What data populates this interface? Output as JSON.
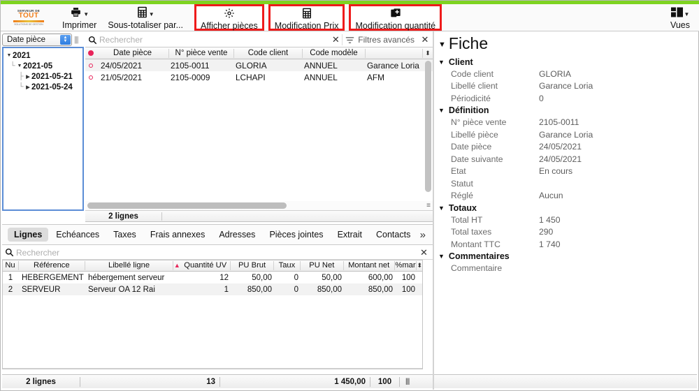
{
  "toolbar": {
    "logo": {
      "line1": "SERVEUR DE",
      "line2": "TOUT",
      "line4": "SOLUTIONS DE GESTION"
    },
    "items": [
      {
        "label": "Imprimer",
        "icon": "printer-icon",
        "caret": true,
        "highlight": false
      },
      {
        "label": "Sous-totaliser par...",
        "icon": "calculator-icon",
        "caret": true,
        "highlight": false
      },
      {
        "label": "Afficher pièces",
        "icon": "gear-icon",
        "caret": false,
        "highlight": true
      },
      {
        "label": "Modification Prix",
        "icon": "calculator-icon",
        "caret": false,
        "highlight": true
      },
      {
        "label": "Modification quantité",
        "icon": "copy-plus-icon",
        "caret": false,
        "highlight": true
      }
    ],
    "views": {
      "label": "Vues",
      "icon": "layout-icon",
      "caret": true
    }
  },
  "left_panel": {
    "selector_value": "Date pièce",
    "tree": [
      {
        "label": "2021",
        "depth": 0,
        "expanded": true
      },
      {
        "label": "2021-05",
        "depth": 1,
        "expanded": true
      },
      {
        "label": "2021-05-21",
        "depth": 2,
        "expanded": false
      },
      {
        "label": "2021-05-24",
        "depth": 2,
        "expanded": false
      }
    ]
  },
  "upper_grid": {
    "search_placeholder": "Rechercher",
    "search_value": "",
    "advanced_filters_label": "Filtres avancés",
    "columns": [
      "Date pièce",
      "N° pièce vente",
      "Code client",
      "Code modèle",
      ""
    ],
    "rows": [
      [
        "24/05/2021",
        "2105-0011",
        "GLORIA",
        "ANNUEL",
        "Garance Loria"
      ],
      [
        "21/05/2021",
        "2105-0009",
        "LCHAPI",
        "ANNUEL",
        "AFM"
      ]
    ],
    "count_label": "2 lignes"
  },
  "tabs": {
    "items": [
      "Lignes",
      "Echéances",
      "Taxes",
      "Frais annexes",
      "Adresses",
      "Pièces jointes",
      "Extrait",
      "Contacts"
    ],
    "active": "Lignes",
    "more_icon": "chevron-double-right-icon"
  },
  "lower_grid": {
    "search_placeholder": "Rechercher",
    "search_value": "",
    "columns": [
      "Nu",
      "Référence",
      "Libellé ligne",
      "Quantité UV",
      "PU Brut",
      "Taux",
      "PU Net",
      "Montant net",
      "%mar"
    ],
    "sort_column": "Libellé ligne",
    "rows": [
      {
        "num": "1",
        "reference": "HEBERGEMENT",
        "libelle": "hébergement serveur",
        "quantite": "12",
        "pu_brut": "50,00",
        "taux": "0",
        "pu_net": "50,00",
        "montant_net": "600,00",
        "marge": "100"
      },
      {
        "num": "2",
        "reference": "SERVEUR",
        "libelle": "Serveur OA 12 Rai",
        "quantite": "1",
        "pu_brut": "850,00",
        "taux": "0",
        "pu_net": "850,00",
        "montant_net": "850,00",
        "marge": "100"
      }
    ]
  },
  "statusbar": {
    "count_label": "2 lignes",
    "total_quantity": "13",
    "total_amount": "1 450,00",
    "total_margin": "100"
  },
  "fiche": {
    "title": "Fiche",
    "sections": [
      {
        "name": "Client",
        "fields": [
          {
            "key": "Code client",
            "value": "GLORIA"
          },
          {
            "key": "Libellé client",
            "value": "Garance Loria"
          },
          {
            "key": "Périodicité",
            "value": "0"
          }
        ]
      },
      {
        "name": "Définition",
        "fields": [
          {
            "key": "N° pièce vente",
            "value": "2105-0011"
          },
          {
            "key": "Libellé pièce",
            "value": "Garance Loria"
          },
          {
            "key": "Date pièce",
            "value": "24/05/2021"
          },
          {
            "key": "Date suivante",
            "value": "24/05/2021"
          },
          {
            "key": "Etat",
            "value": "En cours"
          },
          {
            "key": "Statut",
            "value": ""
          },
          {
            "key": "Réglé",
            "value": "Aucun"
          }
        ]
      },
      {
        "name": "Totaux",
        "fields": [
          {
            "key": "Total HT",
            "value": "1 450"
          },
          {
            "key": "Total taxes",
            "value": "290"
          },
          {
            "key": "Montant TTC",
            "value": "1 740"
          }
        ]
      },
      {
        "name": "Commentaires",
        "fields": [
          {
            "key": "Commentaire",
            "value": ""
          }
        ]
      }
    ]
  },
  "colors": {
    "accent_green": "#7ed321",
    "highlight_red": "#ee1b1b",
    "selection_blue": "#5b8dd6",
    "marker_red": "#e8245a"
  }
}
